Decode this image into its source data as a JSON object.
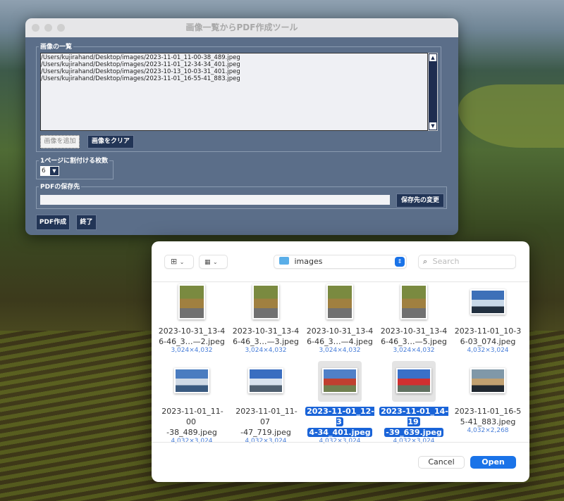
{
  "app": {
    "title": "画像一覧からPDF作成ツール",
    "image_list": {
      "label": "画像の一覧",
      "items": [
        "/Users/kujirahand/Desktop/images/2023-11-01_11-00-38_489.jpeg",
        "/Users/kujirahand/Desktop/images/2023-11-01_12-34-34_401.jpeg",
        "/Users/kujirahand/Desktop/images/2023-10-13_10-03-31_401.jpeg",
        "/Users/kujirahand/Desktop/images/2023-11-01_16-55-41_883.jpeg"
      ],
      "add_label": "画像を追加",
      "clear_label": "画像をクリア"
    },
    "per_page": {
      "label": "1ページに割付ける枚数",
      "value": "6"
    },
    "save_to": {
      "label": "PDFの保存先",
      "value": "",
      "change_label": "保存先の変更"
    },
    "create_label": "PDF作成",
    "quit_label": "終了"
  },
  "dialog": {
    "folder": "images",
    "search_placeholder": "Search",
    "cancel_label": "Cancel",
    "open_label": "Open",
    "files": [
      {
        "name1": "2023-10-31_13-4",
        "name2": "6-46_3…—2.jpeg",
        "dims": "3,024×4,032",
        "selected": false,
        "colors": [
          "#7a8a40",
          "#a08040",
          "#707070"
        ],
        "portrait": true
      },
      {
        "name1": "2023-10-31_13-4",
        "name2": "6-46_3…—3.jpeg",
        "dims": "3,024×4,032",
        "selected": false,
        "colors": [
          "#7a8a40",
          "#a08040",
          "#707070"
        ],
        "portrait": true
      },
      {
        "name1": "2023-10-31_13-4",
        "name2": "6-46_3…—4.jpeg",
        "dims": "3,024×4,032",
        "selected": false,
        "colors": [
          "#7a8a40",
          "#a08040",
          "#707070"
        ],
        "portrait": true
      },
      {
        "name1": "2023-10-31_13-4",
        "name2": "6-46_3…—5.jpeg",
        "dims": "3,024×4,032",
        "selected": false,
        "colors": [
          "#7a8a40",
          "#a08040",
          "#707070"
        ],
        "portrait": true
      },
      {
        "name1": "2023-11-01_10-3",
        "name2": "6-03_074.jpeg",
        "dims": "4,032×3,024",
        "selected": false,
        "colors": [
          "#3d70b8",
          "#c8d8e8",
          "#223040"
        ],
        "portrait": false
      },
      {
        "name1": "2023-11-01_11-00",
        "name2": "-38_489.jpeg",
        "dims": "4,032×3,024",
        "selected": false,
        "colors": [
          "#4a7cc0",
          "#d0dae6",
          "#3a5a80"
        ],
        "portrait": false
      },
      {
        "name1": "2023-11-01_11-07",
        "name2": "-47_719.jpeg",
        "dims": "4,032×3,024",
        "selected": false,
        "colors": [
          "#3a6ec0",
          "#d8e2ee",
          "#506070"
        ],
        "portrait": false
      },
      {
        "name1": "2023-11-01_12-3",
        "name2": "4-34_401.jpeg",
        "dims": "4,032×3,024",
        "selected": true,
        "colors": [
          "#5080c8",
          "#c04030",
          "#708050"
        ],
        "portrait": false
      },
      {
        "name1": "2023-11-01_14-19",
        "name2": "-39_639.jpeg",
        "dims": "4,032×3,024",
        "selected": true,
        "colors": [
          "#3a70c8",
          "#d03030",
          "#607060"
        ],
        "portrait": false
      },
      {
        "name1": "2023-11-01_16-5",
        "name2": "5-41_883.jpeg",
        "dims": "4,032×2,268",
        "selected": false,
        "colors": [
          "#8098a8",
          "#c0a070",
          "#202830"
        ],
        "portrait": false
      }
    ]
  }
}
